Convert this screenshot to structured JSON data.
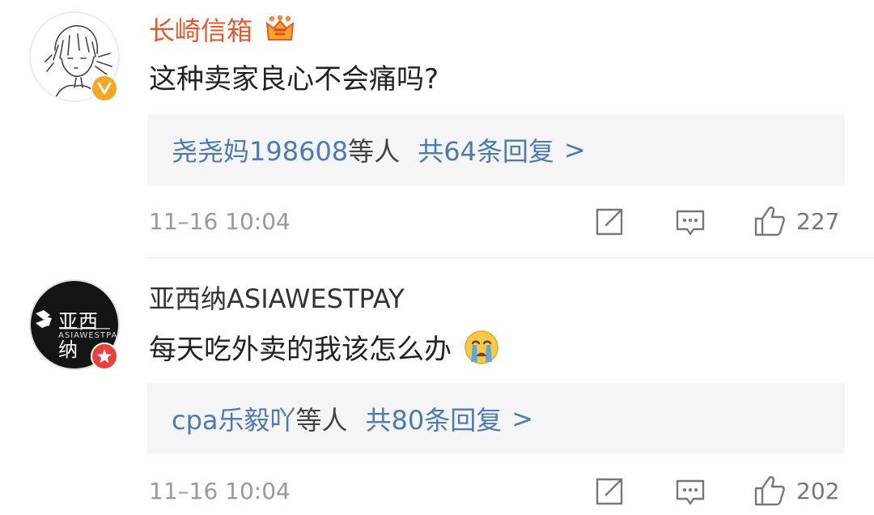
{
  "comments": [
    {
      "username": "长崎信箱",
      "verified_badge": "orange-v-badge-icon",
      "user_icon": "vip-crown-icon",
      "text": "这种卖家良心不会痛吗?",
      "reply_users": "尧尧妈198608",
      "reply_suffix": "等人",
      "reply_count": "共64条回复",
      "reply_arrow": ">",
      "timestamp": "11–16 10:04",
      "likes": "227"
    },
    {
      "username": "亚西纳ASIAWESTPAY",
      "verified_badge": "red-star-badge-icon",
      "avatar_text": "亚西纳",
      "avatar_subtext": "ASIAWESTPAY",
      "text": "每天吃外卖的我该怎么办",
      "text_emoji": "crying-face-icon",
      "reply_users": "cpa乐毅吖",
      "reply_suffix": "等人",
      "reply_count": "共80条回复",
      "reply_arrow": ">",
      "timestamp": "11–16 10:04",
      "likes": "202"
    }
  ],
  "colors": {
    "vip_name": "#e8562a",
    "link": "#4a7ab8",
    "muted": "#999999",
    "reply_bg": "#f5f5f6"
  }
}
